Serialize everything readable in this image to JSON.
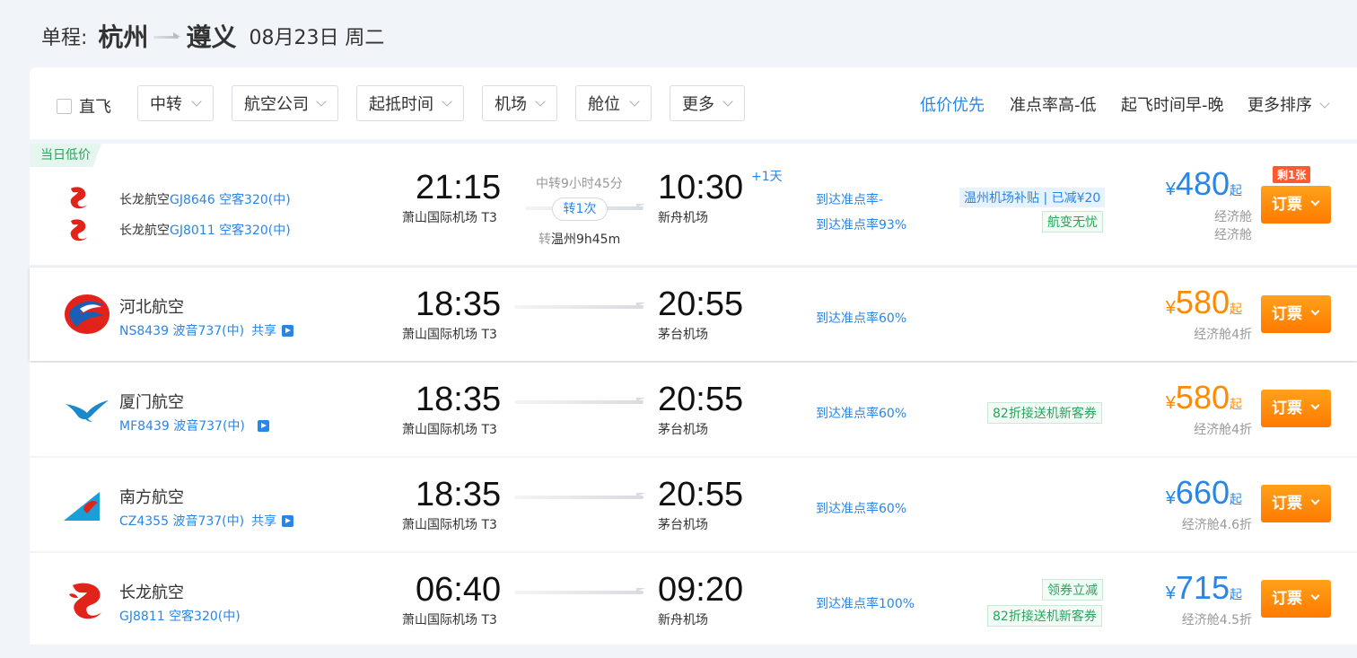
{
  "header": {
    "type_label": "单程:",
    "from_city": "杭州",
    "to_city": "遵义",
    "date": "08月23日 周二"
  },
  "filters": {
    "direct_label": "直飞",
    "dropdowns": [
      "中转",
      "航空公司",
      "起抵时间",
      "机场",
      "舱位",
      "更多"
    ],
    "sorts": [
      "低价优先",
      "准点率高-低",
      "起飞时间早-晚",
      "更多排序"
    ],
    "active_sort": "低价优先"
  },
  "book_label": "订票",
  "flights": [
    {
      "badge": "当日低价",
      "legs": [
        {
          "airline": "长龙航空",
          "flight_no": "GJ8646",
          "aircraft": "空客320(中)"
        },
        {
          "airline": "长龙航空",
          "flight_no": "GJ8011",
          "aircraft": "空客320(中)"
        }
      ],
      "dep_time": "21:15",
      "dep_airport": "萧山国际机场",
      "dep_terminal": "T3",
      "arr_time": "10:30",
      "arr_airport": "新舟机场",
      "plus_day": "+1天",
      "transfer_duration": "中转9小时45分",
      "transfer_count": "转1次",
      "transfer_prefix": "转",
      "transfer_city": "温州9h45m",
      "punctuality": [
        "到达准点率-",
        "到达准点率93%"
      ],
      "tags": [
        "温州机场补贴 | 已减¥20",
        "航变无忧"
      ],
      "price_symbol": "¥",
      "price": "480",
      "price_suffix": "起",
      "cabin": [
        "经济舱",
        "经济舱"
      ],
      "remaining": "剩1张",
      "price_color": "blue"
    },
    {
      "airline": "河北航空",
      "flight_no": "NS8439",
      "aircraft": "波音737(中)",
      "share": "共享",
      "dep_time": "18:35",
      "dep_airport": "萧山国际机场",
      "dep_terminal": "T3",
      "arr_time": "20:55",
      "arr_airport": "茅台机场",
      "punctuality": "到达准点率60%",
      "price_symbol": "¥",
      "price": "580",
      "price_suffix": "起",
      "cabin": "经济舱4折",
      "price_color": "orange"
    },
    {
      "airline": "厦门航空",
      "flight_no": "MF8439",
      "aircraft": "波音737(中)",
      "dep_time": "18:35",
      "dep_airport": "萧山国际机场",
      "dep_terminal": "T3",
      "arr_time": "20:55",
      "arr_airport": "茅台机场",
      "punctuality": "到达准点率60%",
      "tags": [
        "82折接送机新客券"
      ],
      "price_symbol": "¥",
      "price": "580",
      "price_suffix": "起",
      "cabin": "经济舱4折",
      "price_color": "orange"
    },
    {
      "airline": "南方航空",
      "flight_no": "CZ4355",
      "aircraft": "波音737(中)",
      "share": "共享",
      "dep_time": "18:35",
      "dep_airport": "萧山国际机场",
      "dep_terminal": "T3",
      "arr_time": "20:55",
      "arr_airport": "茅台机场",
      "punctuality": "到达准点率60%",
      "price_symbol": "¥",
      "price": "660",
      "price_suffix": "起",
      "cabin": "经济舱4.6折",
      "price_color": "blue"
    },
    {
      "airline": "长龙航空",
      "flight_no": "GJ8811",
      "aircraft": "空客320(中)",
      "dep_time": "06:40",
      "dep_airport": "萧山国际机场",
      "dep_terminal": "T3",
      "arr_time": "09:20",
      "arr_airport": "新舟机场",
      "punctuality": "到达准点率100%",
      "tags": [
        "领券立减",
        "82折接送机新客券"
      ],
      "price_symbol": "¥",
      "price": "715",
      "price_suffix": "起",
      "cabin": "经济舱4.5折",
      "price_color": "blue"
    }
  ],
  "colors": {
    "accent_blue": "#2a86e6",
    "price_orange": "#ff8a00",
    "book_button": "#ff8a00",
    "tag_green": "#2aa35c"
  }
}
